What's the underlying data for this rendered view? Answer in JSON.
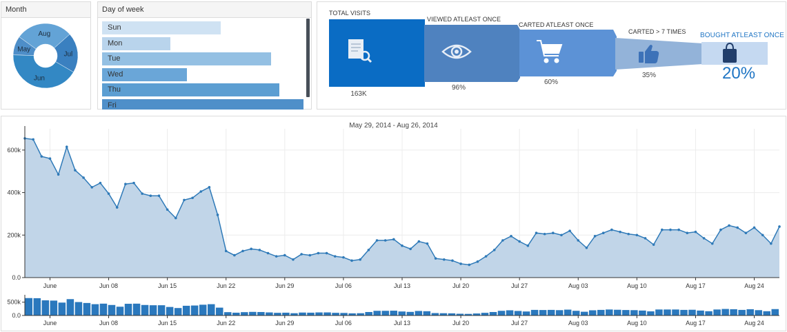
{
  "month_panel": {
    "title": "Month",
    "slices": [
      {
        "label": "May",
        "value": 9.5,
        "color": "#4e8ec8"
      },
      {
        "label": "Aug",
        "value": 28.5,
        "color": "#63a3d6"
      },
      {
        "label": "Jul",
        "value": 20,
        "color": "#3a80c0"
      },
      {
        "label": "Jun",
        "value": 42,
        "color": "#3388c4"
      }
    ]
  },
  "dow_panel": {
    "title": "Day of week",
    "days": [
      {
        "label": "Sun",
        "value": 0.59,
        "color": "#cfe2f3"
      },
      {
        "label": "Mon",
        "value": 0.34,
        "color": "#b9d4ec"
      },
      {
        "label": "Tue",
        "value": 0.84,
        "color": "#94c0e3"
      },
      {
        "label": "Wed",
        "value": 0.42,
        "color": "#6aa6d8"
      },
      {
        "label": "Thu",
        "value": 0.88,
        "color": "#5c9ed2"
      },
      {
        "label": "Fri",
        "value": 1.0,
        "color": "#4f8fc9"
      }
    ]
  },
  "funnel": {
    "steps": [
      {
        "label": "TOTAL VISITS",
        "value": "163K",
        "icon": "document-search-icon",
        "color": "#0a6cc4"
      },
      {
        "label": "VIEWED ATLEAST ONCE",
        "value": "96%",
        "icon": "eye-icon",
        "color": "#4f82bf"
      },
      {
        "label": "CARTED ATLEAST ONCE",
        "value": "60%",
        "icon": "cart-icon",
        "color": "#5c92d6"
      },
      {
        "label": "CARTED > 7 TIMES",
        "value": "35%",
        "icon": "thumbs-up-icon",
        "color": "#93b3d9"
      },
      {
        "label": "BOUGHT ATLEAST ONCE",
        "value": "20%",
        "icon": "shopping-bag-icon",
        "color": "#c5d9f1"
      }
    ],
    "accent_color": "#1f75c4"
  },
  "timeline": {
    "title": "May 29, 2014 - Aug 26, 2014"
  },
  "chart_data": {
    "type": "area",
    "title": "May 29, 2014 - Aug 26, 2014",
    "series": [
      {
        "values": [
          655,
          650,
          570,
          560,
          485,
          615,
          505,
          470,
          425,
          445,
          395,
          330,
          440,
          445,
          395,
          385,
          385,
          320,
          280,
          365,
          375,
          405,
          425,
          295,
          125,
          105,
          125,
          135,
          130,
          115,
          100,
          105,
          85,
          110,
          105,
          115,
          115,
          100,
          95,
          80,
          85,
          130,
          175,
          175,
          180,
          150,
          135,
          170,
          160,
          90,
          85,
          80,
          65,
          60,
          75,
          100,
          130,
          175,
          195,
          170,
          150,
          210,
          205,
          210,
          200,
          220,
          175,
          140,
          195,
          210,
          225,
          215,
          205,
          200,
          185,
          155,
          225,
          225,
          225,
          210,
          215,
          185,
          160,
          225,
          245,
          235,
          210,
          235,
          200,
          160,
          240
        ]
      }
    ],
    "x_start": "2014-05-29",
    "x_tick_labels": [
      "June",
      "Jun 08",
      "Jun 15",
      "Jun 22",
      "Jun 29",
      "Jul 06",
      "Jul 13",
      "Jul 20",
      "Jul 27",
      "Aug 03",
      "Aug 10",
      "Aug 17",
      "Aug 24"
    ],
    "y_tick_labels": [
      "0.0",
      "200k",
      "400k",
      "600k"
    ],
    "ylim": [
      0,
      700
    ],
    "grid": true,
    "area_color": "#c1d5e8",
    "line_color": "#2f7ab8",
    "brush": {
      "y_tick_labels": [
        "0.0",
        "500k"
      ],
      "bar_color": "#2a78bd",
      "ylim": [
        0,
        700
      ]
    }
  }
}
